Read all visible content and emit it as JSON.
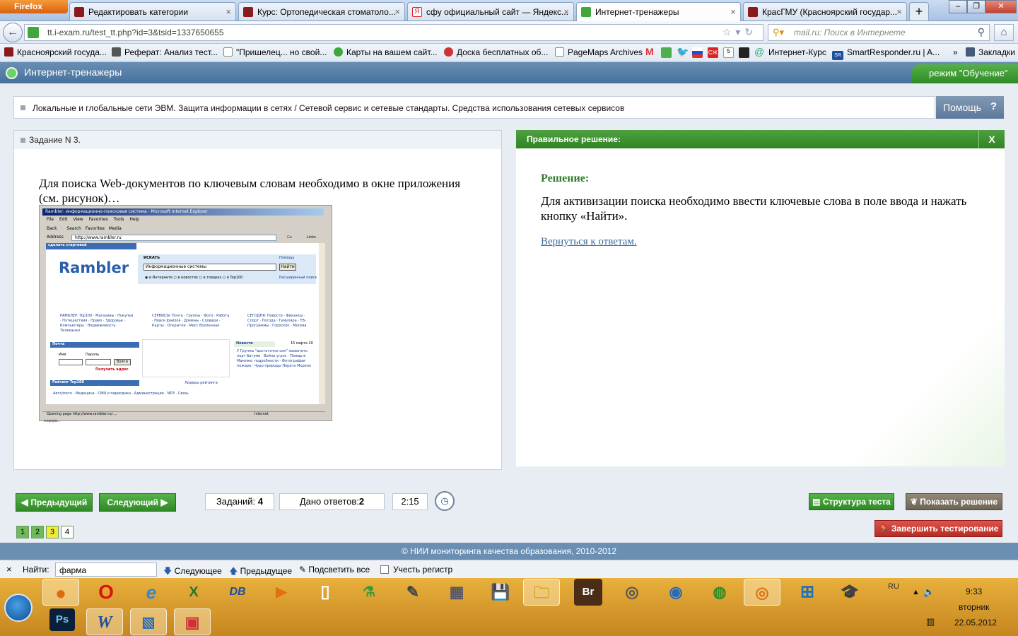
{
  "browser": {
    "app_button": "Firefox",
    "tabs": [
      {
        "label": "Редактировать категории",
        "color": "#8b1a1a"
      },
      {
        "label": "Курс: Ортопедическая стоматоло...",
        "color": "#8b1a1a"
      },
      {
        "label": "сфу официальный сайт — Яндекс...",
        "color": "#e02020"
      },
      {
        "label": "Интернет-тренажеры",
        "color": "#3fa73b",
        "active": true
      },
      {
        "label": "КрасГМУ (Красноярский государ...",
        "color": "#8b1a1a"
      }
    ],
    "new_tab": "+",
    "url": "tt.i-exam.ru/test_tt.php?id=3&tsid=1337650655",
    "search_placeholder": "mail.ru: Поиск в Интернете",
    "bookmarks": [
      "Красноярский госуда...",
      "Реферат: Анализ тест...",
      "\"Пришелец... но свой...",
      "Карты на вашем сайт...",
      "Доска бесплатных об...",
      "PageMaps Archives",
      "Интернет-Курс",
      "SmartResponder.ru | A...",
      "Закладки"
    ],
    "bookmarks_more": "»"
  },
  "app": {
    "title": "Интернет-тренажеры",
    "mode": "режим \"Обучение\"",
    "topic": "Локальные и глобальные сети ЭВМ. Защита информации в сетях / Сетевой сервис и сетевые стандарты. Средства использования сетевых сервисов",
    "help": "Помощь",
    "help_icon": "?"
  },
  "task": {
    "header": "Задание N 3.",
    "question": "Для поиска Web-документов по ключевым словам необходимо в окне приложения (см. рисунок)…"
  },
  "figure": {
    "window_title": "Rambler: информационно-поисковая система - Microsoft Internet Explorer",
    "menu": "File Edit View Favorites Tools Help",
    "toolbar": "Back · Search Favorites Media",
    "address_label": "Address",
    "address": "http://www.rambler.ru",
    "go": "Go",
    "links": "Links",
    "make_start": "сделать стартовой",
    "logo": "Rambler",
    "search_label": "ИСКАТЬ",
    "search_value": "Информационные системы",
    "search_btn": "Найти",
    "help_link": "Помощь",
    "adv_link": "Расширенный поиск",
    "scopes": "◉ в Интернете ○ в новостях ○ в товарах ○ в Top100",
    "rambler_col": "РАМБЛЕР: Top100 · Магазины · Покупки · Путешествия · Право · Здоровье · Компьютеры · Недвижимость · Телеканал",
    "services_col": "СЕРВИСЫ: Почта · Группы · Фото · Работа · Поиск файлов · Домены · Словари · Карты · Открытки · Мисс Вселенная",
    "today_col": "СЕГОДНЯ: Новости · Финансы · Спорт · Погода · Гумуляра · ТВ-Программы · Гороскоп · Москва",
    "mail_box": "Почта",
    "login": "Имя",
    "password": "Пароль",
    "enter": "Войти",
    "get_address": "Получить адрес",
    "news": "Новости",
    "news_date": "15 марта 20",
    "news_items": "У Группы \"достаточно сил\" захватить порт Батуми · Война угроз · Пожар в Манеже: подробности · Фотографии пожара · Чудо природы Перито Морено",
    "top100": "Рейтинг Top100",
    "top100_leaders": "Лидеры рейтинга",
    "categories": "Авто/мото · Медицина · СМИ и периодика · Администрация · MP3 · Связь",
    "status": "Opening page http://www.rambler.ru/....",
    "zone": "Internet",
    "caption": "Информ..."
  },
  "solution": {
    "header": "Правильное решение:",
    "close": "X",
    "title": "Решение:",
    "text": "Для активизации поиска необходимо ввести ключевые слова в поле ввода и нажать кнопку «Найти».",
    "back_link": "Вернуться к ответам."
  },
  "nav": {
    "prev": "Предыдущий",
    "next": "Следующий",
    "tasks_label": "Заданий:",
    "tasks_value": "4",
    "answered_label": "Дано ответов:",
    "answered_value": "2",
    "timer": "2:15",
    "pages": [
      {
        "n": "1",
        "state": "answered",
        "color": "#6dbb5c"
      },
      {
        "n": "2",
        "state": "answered",
        "color": "#6dbb5c"
      },
      {
        "n": "3",
        "state": "current",
        "color": "#f0ea3a"
      },
      {
        "n": "4",
        "state": "empty",
        "color": "#ffffff"
      }
    ],
    "structure": "Структура теста",
    "show_solution": "Показать решение",
    "finish": "Завершить тестирование"
  },
  "footer": "© НИИ мониторинга качества образования, 2010-2012",
  "findbar": {
    "close": "×",
    "label": "Найти:",
    "value": "фарма",
    "next": "Следующее",
    "prev": "Предыдущее",
    "highlight": "Подсветить все",
    "match_case": "Учесть регистр"
  },
  "taskbar": {
    "lang": "RU",
    "time": "9:33",
    "day": "вторник",
    "date": "22.05.2012",
    "apps": [
      "firefox-icon",
      "opera-icon",
      "ie-icon",
      "excel-icon",
      "db-icon",
      "media-icon",
      "file-icon",
      "network-icon",
      "paint-icon",
      "calculator-icon",
      "floppy-icon",
      "folder-icon",
      "bridge-icon",
      "disk-icon",
      "globe-icon",
      "wifi-icon",
      "antivirus-icon",
      "windows-grid-icon",
      "graduate-icon",
      "photoshop-icon",
      "word-icon",
      "paint-app-icon",
      "powerpoint-icon"
    ]
  }
}
